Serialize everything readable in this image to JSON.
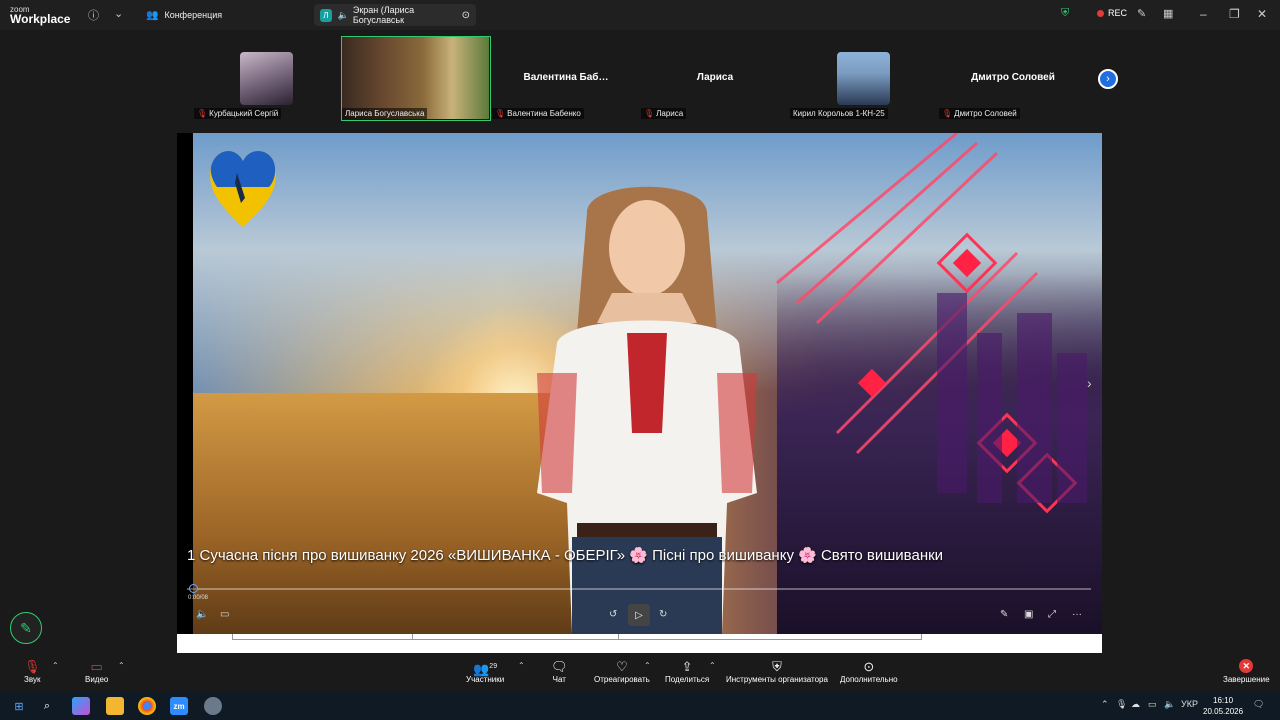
{
  "app": {
    "brand_top": "zoom",
    "brand_bottom": "Workplace"
  },
  "tabs": [
    {
      "label": "Конференция"
    },
    {
      "label": "Экран (Лариса Богуславськ",
      "badge": "Л"
    }
  ],
  "recording": {
    "label": "REC"
  },
  "participants_strip": [
    {
      "name": "Курбацький Сергій",
      "muted": true,
      "has_video": true
    },
    {
      "name": "Лариса Богуславська",
      "muted": false,
      "has_video": true,
      "active": true
    },
    {
      "name": "Валентина Бабенко",
      "display": "Валентина Баб…",
      "muted": true,
      "has_video": false
    },
    {
      "name": "Лариса",
      "display": "Лариса",
      "muted": true,
      "has_video": false
    },
    {
      "name": "Кирил Корольов 1-КН-25",
      "muted": false,
      "has_video": true
    },
    {
      "name": "Дмитро Соловей",
      "display": "Дмитро Соловей",
      "muted": true,
      "has_video": false
    }
  ],
  "video": {
    "title": "1 Сучасна пісня про вишиванку 2026 «ВИШИВАНКА - ОБЕРІГ» 🌸 Пісні про вишиванку 🌸 Свято вишиванки",
    "time": "0:00/08",
    "progress": 0.0
  },
  "toolbar": {
    "audio": "Звук",
    "video": "Видео",
    "participants": "Участники",
    "participants_count": "29",
    "chat": "Чат",
    "react": "Отреагировать",
    "share": "Поделиться",
    "host_tools": "Инструменты организатора",
    "more": "Дополнительно",
    "end": "Завершение"
  },
  "taskbar": {
    "language": "УКР",
    "time": "16:10",
    "date": "20.05.2026"
  },
  "colors": {
    "accent": "#1f6fe0",
    "active_border": "#2ecc71",
    "danger": "#e53935"
  }
}
